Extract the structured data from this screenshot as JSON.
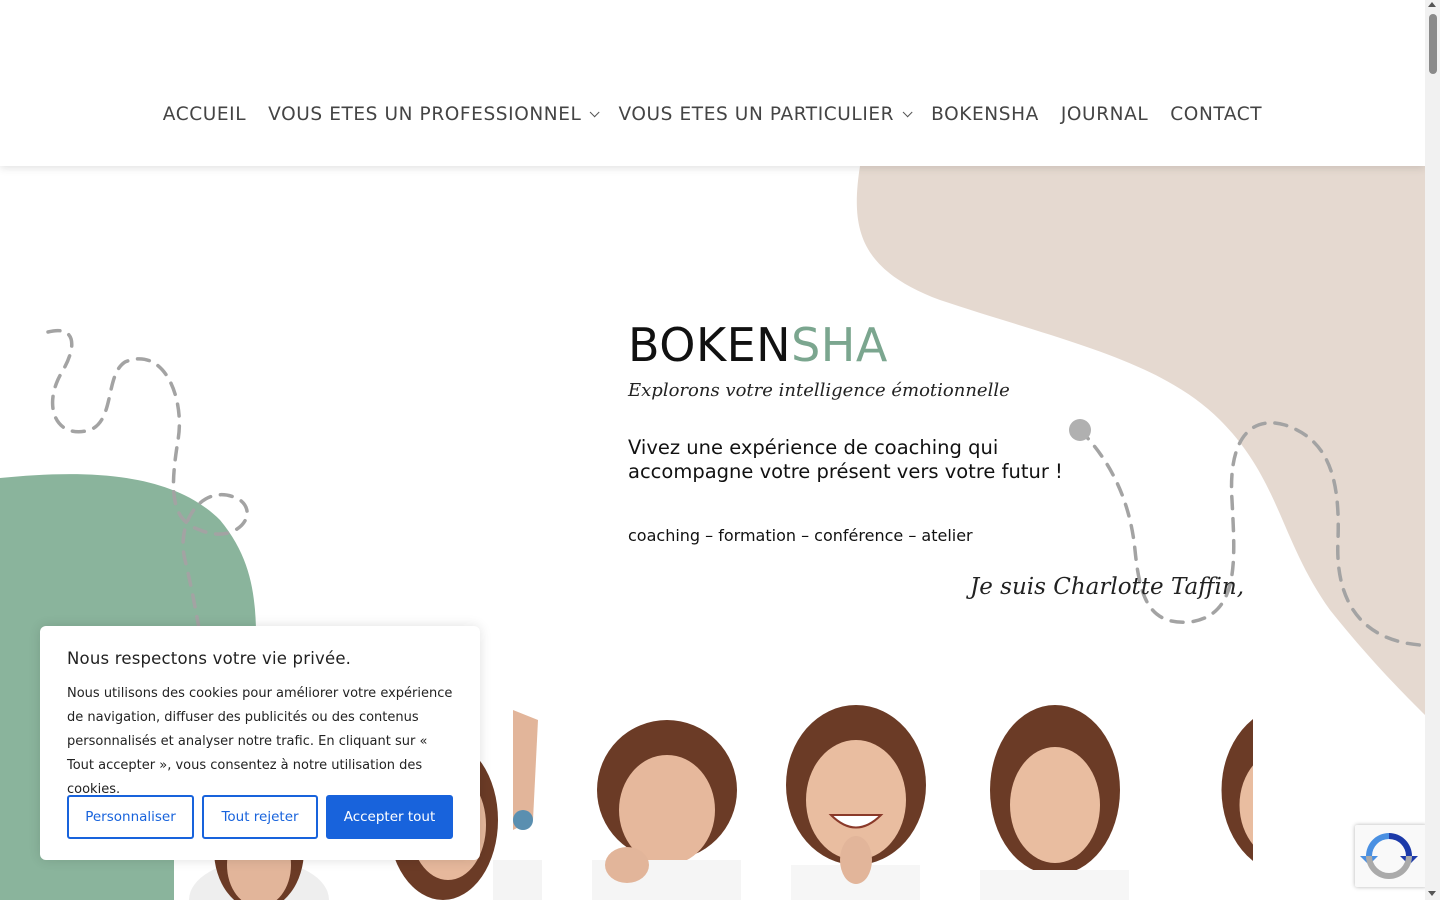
{
  "nav": {
    "items": [
      {
        "label": "ACCUEIL",
        "dropdown": false
      },
      {
        "label": "VOUS ETES UN PROFESSIONNEL",
        "dropdown": true
      },
      {
        "label": "VOUS ETES UN PARTICULIER",
        "dropdown": true
      },
      {
        "label": "BOKENSHA",
        "dropdown": false
      },
      {
        "label": "JOURNAL",
        "dropdown": false
      },
      {
        "label": "CONTACT",
        "dropdown": false
      }
    ]
  },
  "hero": {
    "title_part1": "BOKEN",
    "title_part2": "SHA",
    "subtitle": "Explorons votre intelligence émotionnelle",
    "lead": "Vivez une expérience de coaching qui accompagne votre présent vers votre futur !",
    "services": "coaching – formation – conférence – atelier",
    "signature": "Je suis Charlotte Taffin,"
  },
  "cookie": {
    "title": "Nous respectons votre vie privée.",
    "text": "Nous utilisons des cookies pour améliorer votre expérience de navigation, diffuser des publicités ou des contenus personnalisés et analyser notre trafic. En cliquant sur « Tout accepter », vous consentez à notre utilisation des cookies.",
    "customize_label": "Personnaliser",
    "reject_label": "Tout rejeter",
    "accept_label": "Accepter tout"
  },
  "colors": {
    "accent_green": "#7ba68f",
    "blob_beige": "#e5d9d0",
    "blob_green": "#8ab49c",
    "cookie_blue": "#1863dc"
  },
  "icons": {
    "recaptcha": "recaptcha-icon",
    "dropdown": "chevron-down-icon"
  }
}
